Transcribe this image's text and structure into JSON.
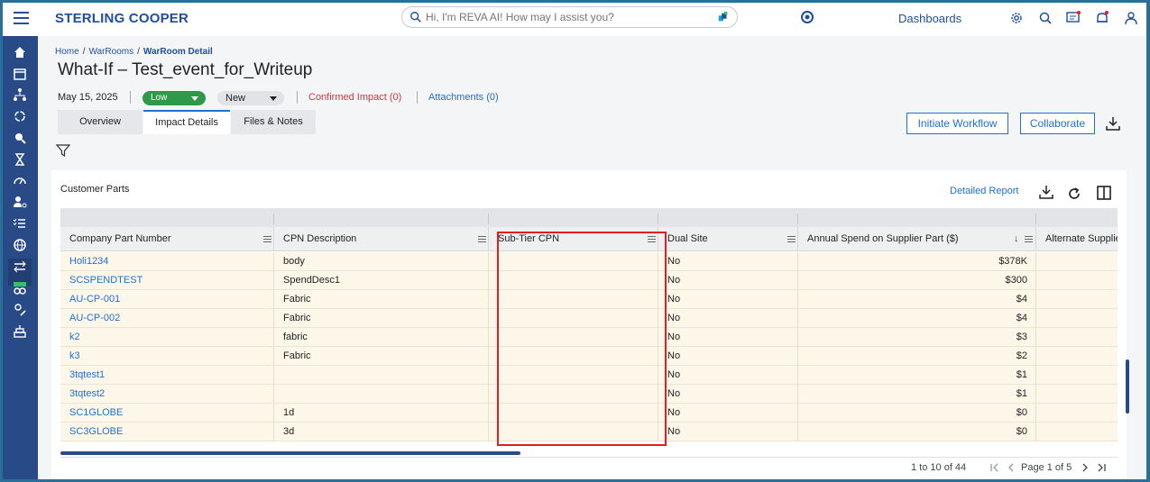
{
  "app": {
    "brand": "STERLING COOPER",
    "search_placeholder": "Hi, I'm REVA AI! How may I assist you?",
    "dashboards_label": "Dashboards"
  },
  "breadcrumb": {
    "items": [
      "Home",
      "WarRooms"
    ],
    "current": "WarRoom Detail"
  },
  "page": {
    "title": "What-If – Test_event_for_Writeup",
    "date": "May 15, 2025",
    "priority": "Low",
    "status": "New",
    "confirmed_impact": "Confirmed Impact (0)",
    "attachments": "Attachments (0)"
  },
  "tabs": [
    {
      "label": "Overview",
      "active": false
    },
    {
      "label": "Impact Details",
      "active": true
    },
    {
      "label": "Files & Notes",
      "active": false
    }
  ],
  "actions": {
    "initiate_workflow": "Initiate Workflow",
    "collaborate": "Collaborate"
  },
  "card": {
    "title": "Customer Parts",
    "detailed_report": "Detailed Report"
  },
  "grid": {
    "columns": [
      "Company Part Number",
      "CPN Description",
      "Sub-Tier CPN",
      "Dual Site",
      "Annual Spend on Supplier Part ($)",
      "Alternate Supplier"
    ],
    "sort_indicator": "↓",
    "rows": [
      [
        "Holi1234",
        "body",
        "",
        "No",
        "$378K",
        ""
      ],
      [
        "SCSPENDTEST",
        "SpendDesc1",
        "",
        "No",
        "$300",
        ""
      ],
      [
        "AU-CP-001",
        "Fabric",
        "",
        "No",
        "$4",
        ""
      ],
      [
        "AU-CP-002",
        "Fabric",
        "",
        "No",
        "$4",
        ""
      ],
      [
        "k2",
        "fabric",
        "",
        "No",
        "$3",
        ""
      ],
      [
        "k3",
        "Fabric",
        "",
        "No",
        "$2",
        ""
      ],
      [
        "3tqtest1",
        "",
        "",
        "No",
        "$1",
        ""
      ],
      [
        "3tqtest2",
        "",
        "",
        "No",
        "$1",
        ""
      ],
      [
        "SC1GLOBE",
        "1d",
        "",
        "No",
        "$0",
        ""
      ],
      [
        "SC3GLOBE",
        "3d",
        "",
        "No",
        "$0",
        ""
      ]
    ]
  },
  "pager": {
    "summary": "1 to 10 of 44",
    "page_text": "Page 1 of 5"
  },
  "colors": {
    "brand_blue": "#1f4e9c",
    "sidebar": "#284a86",
    "link": "#1f6fd1",
    "priority_low": "#2e9a49",
    "impact_red": "#d8343a",
    "highlight_red": "#e02020",
    "row_bg": "#fdf7ea"
  },
  "sidebar_icons": [
    "home-icon",
    "calendar-icon",
    "network-icon",
    "refresh-cycle-icon",
    "search-person-icon",
    "hourglass-icon",
    "gauge-icon",
    "user-settings-icon",
    "checklist-icon",
    "globe-icon",
    "transfer-icon",
    "new-feature-icon",
    "edit-user-icon",
    "stack-icon"
  ]
}
